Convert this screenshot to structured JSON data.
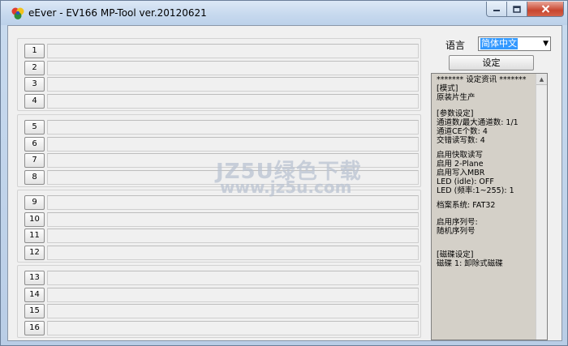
{
  "window": {
    "title": "eEver - EV166 MP-Tool ver.20120621",
    "min_icon": "minimize-icon",
    "max_icon": "maximize-icon",
    "close_icon": "close-icon"
  },
  "rows": [
    "1",
    "2",
    "3",
    "4",
    "5",
    "6",
    "7",
    "8",
    "9",
    "10",
    "11",
    "12",
    "13",
    "14",
    "15",
    "16"
  ],
  "language": {
    "label": "语言",
    "selected": "简体中文"
  },
  "settings_button": "设定",
  "info": {
    "lines": [
      "******* 设定资讯 *******",
      "[模式]",
      "  原装片生产",
      "",
      "[参数设定]",
      "  通道数/最大通道数: 1/1",
      "  通道CE个数: 4",
      "  交错读写数: 4",
      "",
      "  启用快取读写",
      "  启用 2-Plane",
      "  启用写入MBR",
      "  LED (idle): OFF",
      "  LED (频率:1~255): 1",
      "",
      "  档案系统: FAT32",
      "",
      "  启用序列号:",
      "    随机序列号",
      "",
      "",
      "[磁碟设定]",
      "  磁碟 1:  卸除式磁碟"
    ]
  },
  "watermark": {
    "main": "JZ5U绿色下载",
    "sub": "www.jz5u.com"
  },
  "colors": {
    "selection": "#3399ff",
    "close_button": "#c8462f",
    "info_background": "#d4d0c8"
  }
}
